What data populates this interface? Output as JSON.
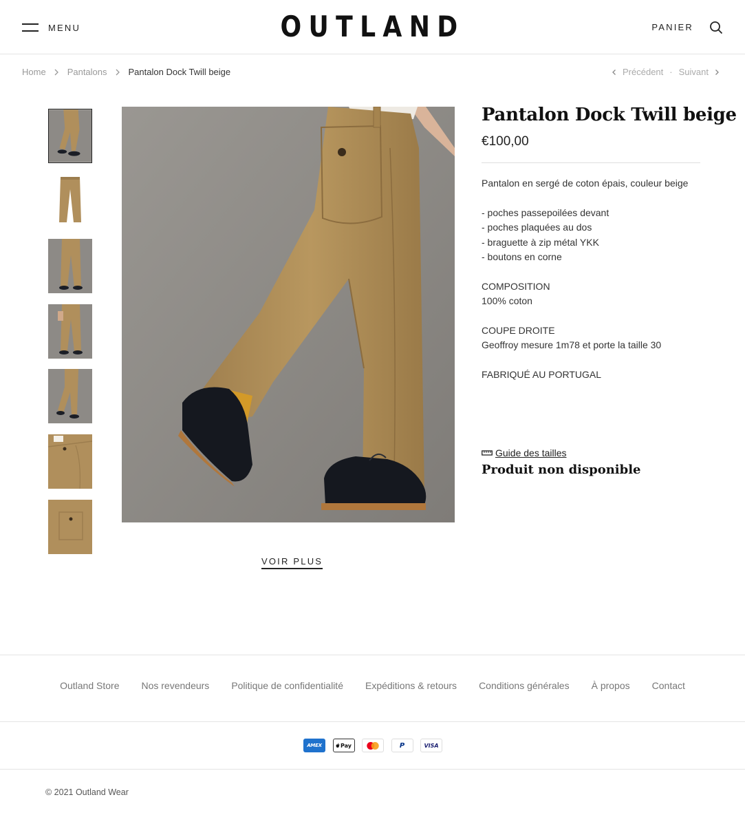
{
  "header": {
    "menu_label": "MENU",
    "logo": "OUTLAND",
    "cart_label": "PANIER"
  },
  "breadcrumb": {
    "items": [
      "Home",
      "Pantalons"
    ],
    "current": "Pantalon Dock Twill beige"
  },
  "pager": {
    "prev_label": "Précédent",
    "separator": "·",
    "next_label": "Suivant"
  },
  "gallery": {
    "thumbnails": [
      "worn-side-walking",
      "flat-front",
      "worn-front",
      "worn-front-hand-in-pocket",
      "worn-side",
      "detail-front-pocket",
      "detail-back-pocket"
    ],
    "active_index": 0,
    "voir_plus_label": "VOIR PLUS"
  },
  "product": {
    "title": "Pantalon Dock Twill beige",
    "price": "€100,00",
    "description": {
      "intro": "Pantalon en sergé de coton épais, couleur beige",
      "features": [
        "- poches passepoilées devant",
        "- poches plaquées au dos",
        "- braguette à zip métal YKK",
        "- boutons en corne"
      ],
      "composition_title": "COMPOSITION",
      "composition_value": "100% coton",
      "fit_title": "COUPE DROITE",
      "fit_value": "Geoffroy mesure 1m78 et porte la taille 30",
      "made_in": "FABRIQUÉ AU PORTUGAL"
    },
    "size_guide_label": "Guide des tailles",
    "availability": "Produit non disponible"
  },
  "footer": {
    "links": [
      "Outland Store",
      "Nos revendeurs",
      "Politique de confidentialité",
      "Expéditions & retours",
      "Conditions générales",
      "À propos",
      "Contact"
    ],
    "payments": [
      "AMEX",
      "Pay",
      "",
      "P",
      "VISA"
    ],
    "copyright": "© 2021 Outland Wear"
  },
  "colors": {
    "fabric": "#b08f5c",
    "backdrop": "#8f8c88",
    "text": "#2b2b2b"
  }
}
